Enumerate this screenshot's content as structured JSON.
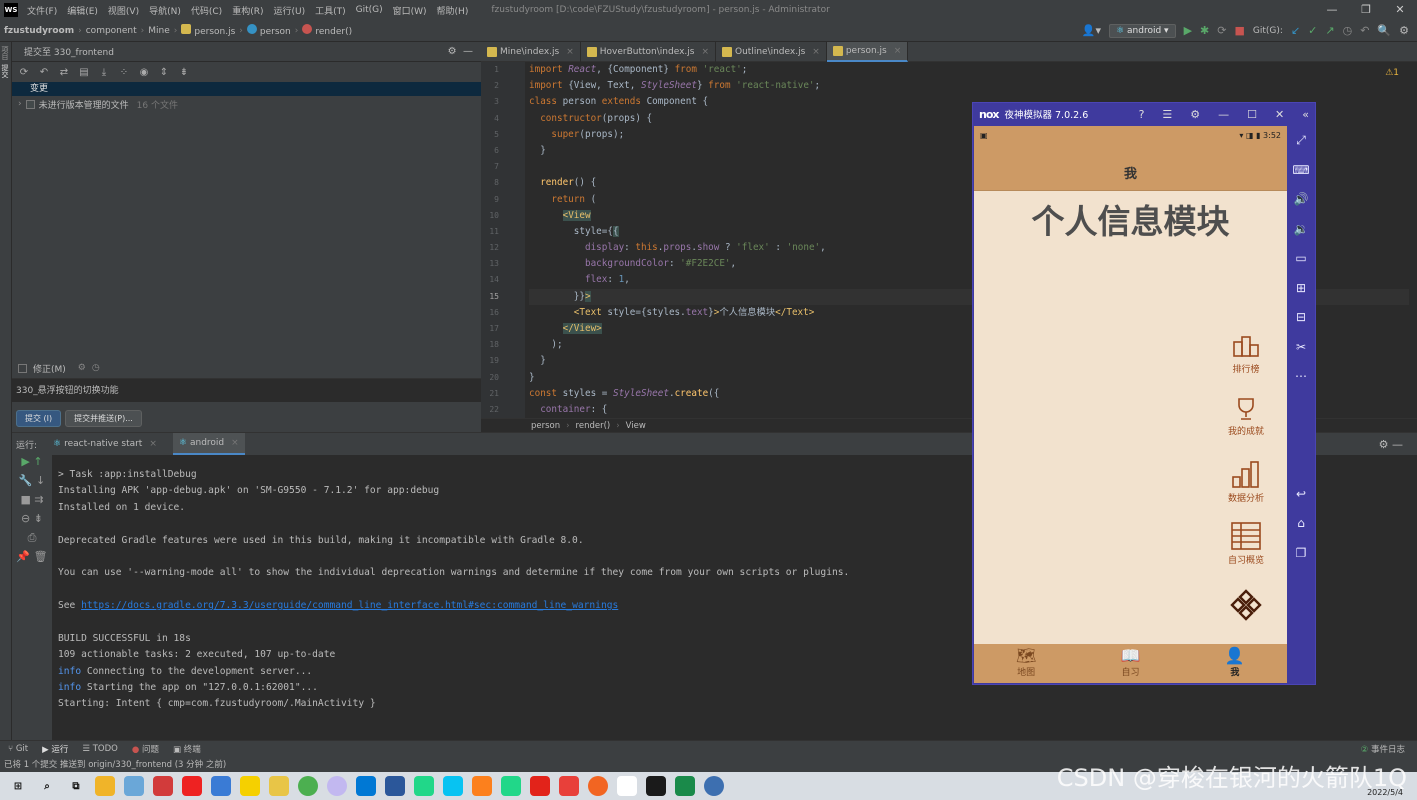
{
  "menubar": {
    "logo": "WS",
    "items": [
      "文件(F)",
      "编辑(E)",
      "视图(V)",
      "导航(N)",
      "代码(C)",
      "重构(R)",
      "运行(U)",
      "工具(T)",
      "Git(G)",
      "窗口(W)",
      "帮助(H)"
    ],
    "title": "fzustudyroom [D:\\code\\FZUStudy\\fzustudyroom] - person.js - Administrator"
  },
  "navbar": {
    "crumbs": [
      "fzustudyroom",
      "component",
      "Mine",
      "person.js",
      "person",
      "render()"
    ],
    "run_config": "android",
    "git_label": "Git(G):"
  },
  "commit_panel": {
    "title": "提交至 330_frontend",
    "changes_label": "变更",
    "unversioned_label": "未进行版本管理的文件",
    "unversioned_count": "16 个文件",
    "amend_label": "修正(M)",
    "message": "330_悬浮按钮的切换功能",
    "commit_button": "提交 (I)",
    "commit_push_button": "提交并推送(P)..."
  },
  "left_strip": [
    "项目",
    "提交"
  ],
  "editor": {
    "tabs": [
      {
        "label": "Mine\\index.js",
        "active": false
      },
      {
        "label": "HoverButton\\index.js",
        "active": false
      },
      {
        "label": "Outline\\index.js",
        "active": false
      },
      {
        "label": "person.js",
        "active": true
      }
    ],
    "line_numbers": [
      "1",
      "2",
      "3",
      "4",
      "5",
      "6",
      "7",
      "8",
      "9",
      "10",
      "11",
      "12",
      "13",
      "14",
      "15",
      "16",
      "17",
      "18",
      "19",
      "20",
      "21",
      "22"
    ],
    "warning": "⚠1",
    "breadcrumb": [
      "person",
      "render()",
      "View"
    ]
  },
  "run_panel": {
    "label": "运行:",
    "tabs": [
      "react-native start",
      "android"
    ],
    "console": [
      {
        "text": "> Task :app:installDebug",
        "kind": "plain"
      },
      {
        "text": "Installing APK 'app-debug.apk' on 'SM-G9550 - 7.1.2' for app:debug",
        "kind": "plain"
      },
      {
        "text": "Installed on 1 device.",
        "kind": "plain"
      },
      {
        "text": "",
        "kind": "plain"
      },
      {
        "text": "Deprecated Gradle features were used in this build, making it incompatible with Gradle 8.0.",
        "kind": "plain"
      },
      {
        "text": "",
        "kind": "plain"
      },
      {
        "text": "You can use '--warning-mode all' to show the individual deprecation warnings and determine if they come from your own scripts or plugins.",
        "kind": "plain"
      },
      {
        "text": "",
        "kind": "plain"
      },
      {
        "text": "See ",
        "kind": "link",
        "link": "https://docs.gradle.org/7.3.3/userguide/command_line_interface.html#sec:command_line_warnings"
      },
      {
        "text": "",
        "kind": "plain"
      },
      {
        "text": "BUILD SUCCESSFUL in 18s",
        "kind": "plain"
      },
      {
        "text": "109 actionable tasks: 2 executed, 107 up-to-date",
        "kind": "plain"
      },
      {
        "prefix": "info",
        "text": " Connecting to the development server...",
        "kind": "info"
      },
      {
        "prefix": "info",
        "text": " Starting the app on \"127.0.0.1:62001\"...",
        "kind": "info"
      },
      {
        "text": "Starting: Intent { cmp=com.fzustudyroom/.MainActivity }",
        "kind": "plain"
      }
    ]
  },
  "bottom_tabs": [
    "Git",
    "运行",
    "TODO",
    "问题",
    "终端"
  ],
  "event_log": "事件日志",
  "status_text": "已将 1 个提交 推送到 origin/330_frontend (3 分钟 之前)",
  "nox": {
    "logo": "nox",
    "title": "夜神模拟器 7.0.2.6",
    "time": "3:52",
    "header": "我",
    "big_title": "个人信息模块",
    "hover_buttons": [
      "排行榜",
      "我的成就",
      "数据分析",
      "自习概览"
    ],
    "tabs": [
      {
        "label": "地图",
        "active": false
      },
      {
        "label": "自习",
        "active": false
      },
      {
        "label": "我",
        "active": true
      }
    ]
  },
  "watermark": "CSDN @穿梭在银河的火箭队1Q",
  "tray_date": "2022/5/4",
  "colors": {
    "accent": "#4a88c7",
    "phone_bg": "#f2e2ce",
    "phone_header": "#cd9a65",
    "nox_frame": "#3f3a9e",
    "hover_icon": "#9b4a1e"
  }
}
